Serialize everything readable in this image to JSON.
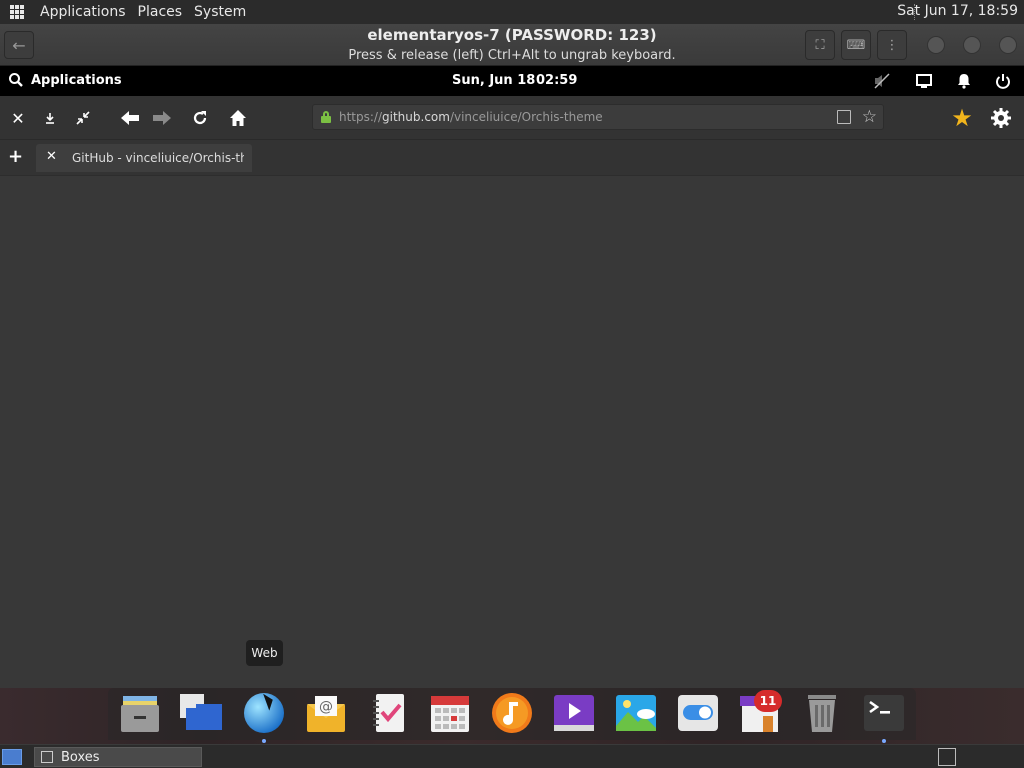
{
  "host_panel": {
    "menus": [
      "Applications",
      "Places",
      "System"
    ],
    "clock": "Sat Jun 17, 18:59"
  },
  "boxes": {
    "title": "elementaryos-7 (PASSWORD: 123)",
    "subtitle": "Press & release (left) Ctrl+Alt to ungrab keyboard.",
    "task_label": "Boxes"
  },
  "guest_panel": {
    "applications_label": "Applications",
    "date": "Sun, Jun 18",
    "time": "02:59"
  },
  "browser": {
    "url_scheme": "https://",
    "url_host": "github.com",
    "url_path": "/vinceliuice/Orchis-theme",
    "tab_title": "GitHub - vinceliuice/Orchis-theme"
  },
  "tooltip": "Web",
  "dock": {
    "items": [
      "Files",
      "Multitasking View",
      "Web",
      "Mail",
      "Tasks",
      "Calendar",
      "Music",
      "Videos",
      "Photos",
      "System Settings",
      "AppCenter",
      "Trash",
      "Terminal"
    ],
    "appcenter_badge": "11"
  }
}
